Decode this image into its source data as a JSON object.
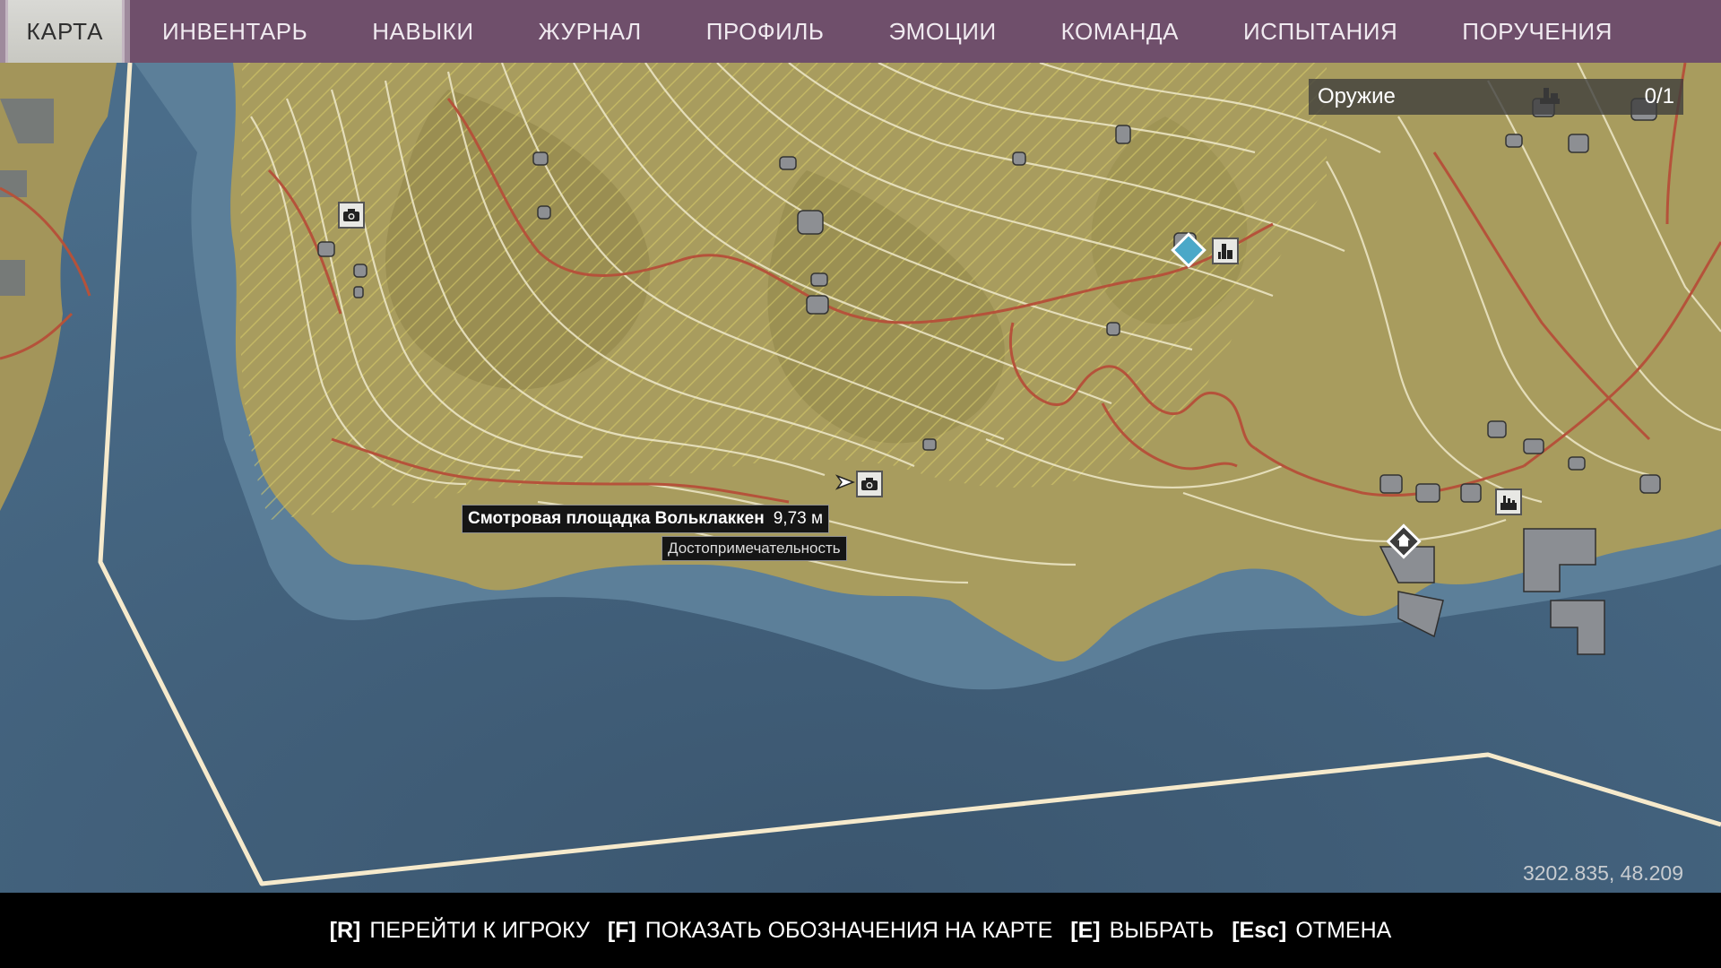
{
  "nav": {
    "active_tab": "КАРТА",
    "tabs": [
      "ИНВЕНТАРЬ",
      "НАВЫКИ",
      "ЖУРНАЛ",
      "ПРОФИЛЬ",
      "ЭМОЦИИ",
      "КОМАНДА",
      "ИСПЫТАНИЯ",
      "ПОРУЧЕНИЯ"
    ]
  },
  "objective": {
    "label": "Оружие",
    "progress": "0/1"
  },
  "tooltip": {
    "name": "Смотровая площадка Вольклаккен",
    "distance": "9,73 м",
    "category": "Достопримечательность"
  },
  "coords": "3202.835, 48.209",
  "hints": [
    {
      "key": "[R]",
      "label": "ПЕРЕЙТИ К ИГРОКУ"
    },
    {
      "key": "[F]",
      "label": "ПОКАЗАТЬ ОБОЗНАЧЕНИЯ НА КАРТЕ"
    },
    {
      "key": "[E]",
      "label": "ВЫБРАТЬ"
    },
    {
      "key": "[Esc]",
      "label": "ОТМЕНА"
    }
  ],
  "colors": {
    "nav_bg": "#6f4f6b",
    "land": "#a89c5e",
    "water": "#4d6f8c",
    "road": "#b2543a",
    "boundary": "#f4e8c8"
  },
  "icons": [
    "camera-icon",
    "camera-icon",
    "camera-icon",
    "player-marker-icon",
    "diamond-waypoint-icon",
    "tower-icon",
    "home-icon",
    "factory-icon",
    "weapon-icon"
  ]
}
